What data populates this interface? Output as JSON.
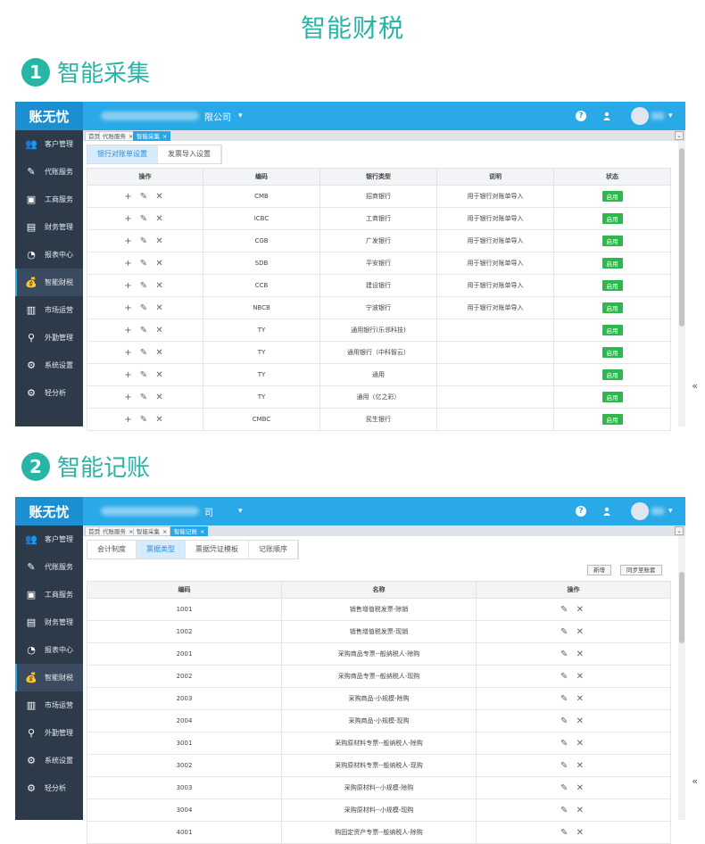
{
  "page": {
    "title": "智能财税",
    "section1": {
      "num": "1",
      "title": "智能采集"
    },
    "section2": {
      "num": "2",
      "title": "智能记账"
    }
  },
  "app": {
    "logo": "账无忧",
    "caret": "▾",
    "help": "?",
    "user_icon": "person-icon",
    "avatar_caret": "▾",
    "collapse": "«"
  },
  "sidebar": [
    {
      "label": "客户管理",
      "icon": "👥"
    },
    {
      "label": "代账服务",
      "icon": "✎"
    },
    {
      "label": "工商服务",
      "icon": "▣"
    },
    {
      "label": "财务管理",
      "icon": "▤"
    },
    {
      "label": "报表中心",
      "icon": "◔"
    },
    {
      "label": "智能财税",
      "icon": "💰"
    },
    {
      "label": "市场运营",
      "icon": "▥"
    },
    {
      "label": "外勤管理",
      "icon": "⚲"
    },
    {
      "label": "系统设置",
      "icon": "⚙"
    },
    {
      "label": "轻分析",
      "icon": "⚙"
    }
  ],
  "screen1": {
    "company": "限公司",
    "tabs": [
      {
        "label": "首页",
        "close": ""
      },
      {
        "label": "代账服务",
        "close": "×"
      },
      {
        "label": "智能采集",
        "close": "×"
      }
    ],
    "subtabs": [
      "银行对账单设置",
      "发票导入设置"
    ],
    "headers": [
      "操作",
      "编码",
      "银行类型",
      "说明",
      "状态"
    ],
    "rows": [
      {
        "ops": "+ ✎ ✕",
        "code": "CMB",
        "type": "招商银行",
        "desc": "用于银行对账单导入",
        "status": "启用"
      },
      {
        "ops": "+ ✎ ✕",
        "code": "ICBC",
        "type": "工商银行",
        "desc": "用于银行对账单导入",
        "status": "启用"
      },
      {
        "ops": "+ ✎ ✕",
        "code": "CGB",
        "type": "广发银行",
        "desc": "用于银行对账单导入",
        "status": "启用"
      },
      {
        "ops": "+ ✎ ✕",
        "code": "SDB",
        "type": "平安银行",
        "desc": "用于银行对账单导入",
        "status": "启用"
      },
      {
        "ops": "+ ✎ ✕",
        "code": "CCB",
        "type": "建设银行",
        "desc": "用于银行对账单导入",
        "status": "启用"
      },
      {
        "ops": "+ ✎ ✕",
        "code": "NBCB",
        "type": "宁波银行",
        "desc": "用于银行对账单导入",
        "status": "启用"
      },
      {
        "ops": "+ ✎ ✕",
        "code": "TY",
        "type": "通用银行(乐邻科技)",
        "desc": "",
        "status": "启用"
      },
      {
        "ops": "+ ✎ ✕",
        "code": "TY",
        "type": "通用银行（中科智云）",
        "desc": "",
        "status": "启用"
      },
      {
        "ops": "+ ✎ ✕",
        "code": "TY",
        "type": "通用",
        "desc": "",
        "status": "启用"
      },
      {
        "ops": "+ ✎ ✕",
        "code": "TY",
        "type": "通用（亿之彩）",
        "desc": "",
        "status": "启用"
      },
      {
        "ops": "+ ✎ ✕",
        "code": "CMBC",
        "type": "民生银行",
        "desc": "",
        "status": "启用"
      }
    ]
  },
  "screen2": {
    "company": "司",
    "tabs": [
      {
        "label": "首页",
        "close": ""
      },
      {
        "label": "代账服务",
        "close": "×"
      },
      {
        "label": "智能采集",
        "close": "×"
      },
      {
        "label": "智能记账",
        "close": "×"
      }
    ],
    "subtabs": [
      "会计制度",
      "票据类型",
      "票据凭证模板",
      "记账顺序"
    ],
    "buttons": {
      "new": "新增",
      "sync": "同步至账套"
    },
    "headers": [
      "编码",
      "名称",
      "操作"
    ],
    "rows": [
      {
        "code": "1001",
        "name": "销售增值税发票-除销",
        "ops": "✎ ✕"
      },
      {
        "code": "1002",
        "name": "销售增值税发票-现销",
        "ops": "✎ ✕"
      },
      {
        "code": "2001",
        "name": "采购商品专票--般纳税人-除购",
        "ops": "✎ ✕"
      },
      {
        "code": "2002",
        "name": "采购商品专票--般纳税人-现购",
        "ops": "✎ ✕"
      },
      {
        "code": "2003",
        "name": "采购商品-小规模-除购",
        "ops": "✎ ✕"
      },
      {
        "code": "2004",
        "name": "采购商品-小规模-现购",
        "ops": "✎ ✕"
      },
      {
        "code": "3001",
        "name": "采购原材料专票--般纳税人-除购",
        "ops": "✎ ✕"
      },
      {
        "code": "3002",
        "name": "采购原材料专票--般纳税人-现购",
        "ops": "✎ ✕"
      },
      {
        "code": "3003",
        "name": "采购原材料--小规模-除购",
        "ops": "✎ ✕"
      },
      {
        "code": "3004",
        "name": "采购原材料--小规模-现购",
        "ops": "✎ ✕"
      },
      {
        "code": "4001",
        "name": "购固定资产专票--般纳税人-除购",
        "ops": "✎ ✕"
      }
    ]
  }
}
